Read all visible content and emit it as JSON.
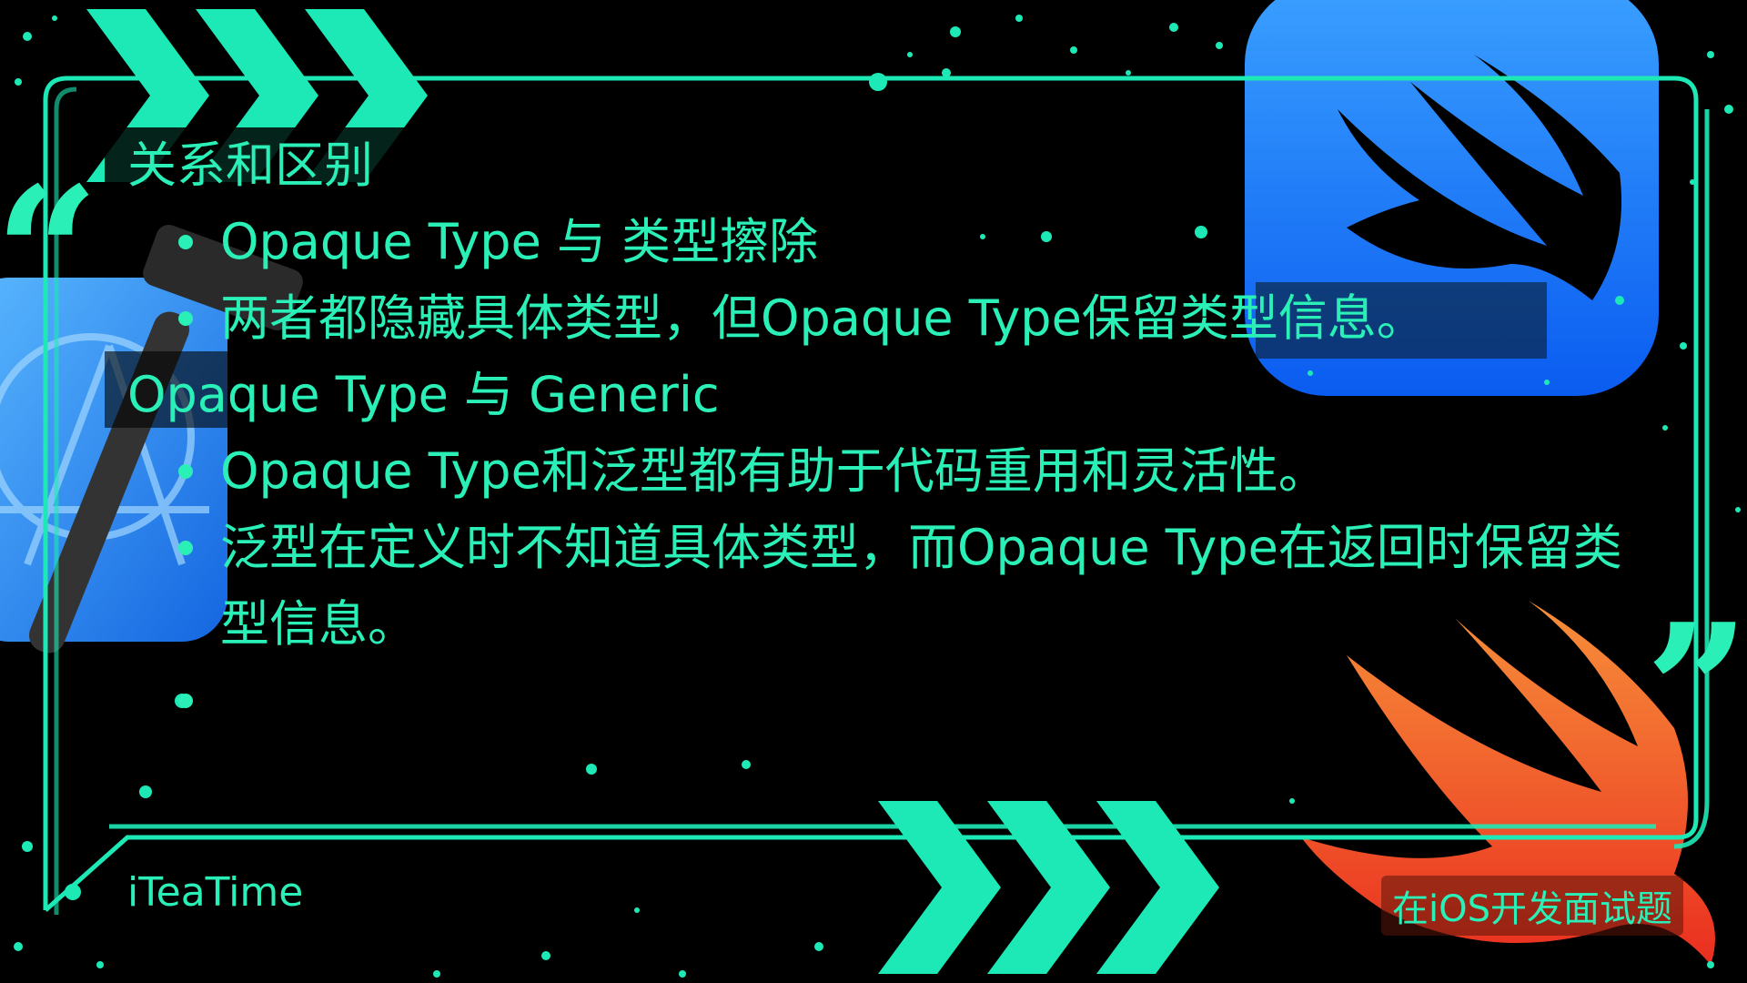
{
  "slide": {
    "sections": [
      {
        "heading": "关系和区别",
        "bullets": [
          "Opaque Type 与 类型擦除",
          "两者都隐藏具体类型，但Opaque Type保留类型信息。"
        ]
      },
      {
        "heading": "Opaque Type 与 Generic",
        "bullets": [
          "Opaque Type和泛型都有助于代码重用和灵活性。",
          "泛型在定义时不知道具体类型，而Opaque Type在返回时保留类型信息。"
        ]
      }
    ],
    "footer_left": "iTeaTime",
    "footer_right": "在iOS开发面试题",
    "quote_open": "“",
    "quote_close": "”"
  },
  "colors": {
    "accent": "#2af0b8",
    "background": "#000000",
    "swiftui_blue": "#1a7cff",
    "swift_orange": "#f05a28"
  },
  "icons": [
    "xcode-icon",
    "swiftui-icon",
    "swift-logo-icon",
    "chevron-arrows-icon",
    "paint-splatter-decoration"
  ]
}
